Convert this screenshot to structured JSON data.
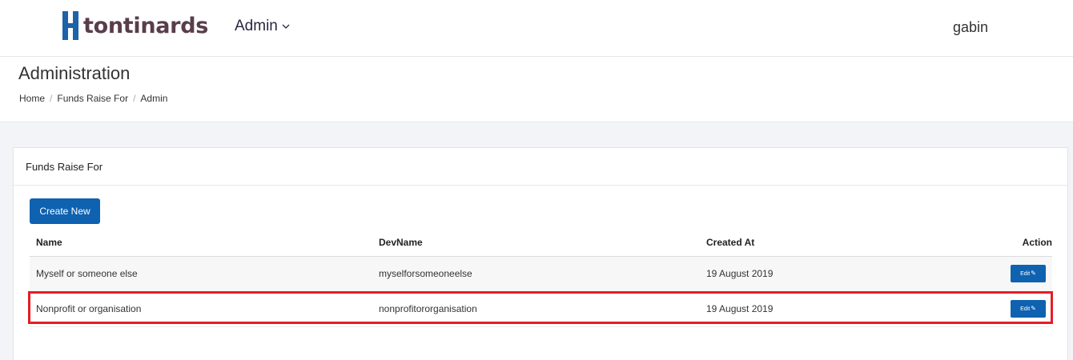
{
  "brand": {
    "name": "tontinards",
    "colors": {
      "logo_blue": "#1e63a8",
      "logo_text": "#5a3d4a"
    }
  },
  "nav": {
    "admin_label": "Admin",
    "user": "gabin"
  },
  "page": {
    "title": "Administration",
    "breadcrumb": [
      "Home",
      "Funds Raise For",
      "Admin"
    ]
  },
  "card": {
    "title": "Funds Raise For",
    "create_label": "Create New",
    "columns": [
      "Name",
      "DevName",
      "Created At",
      "Action"
    ],
    "rows": [
      {
        "name": "Myself or someone else",
        "devname": "myselforsomeoneelse",
        "created": "19 August 2019",
        "action": "Edit"
      },
      {
        "name": "Nonprofit or organisation",
        "devname": "nonprofitororganisation",
        "created": "19 August 2019",
        "action": "Edit"
      }
    ]
  },
  "colors": {
    "primary": "#0e62b0",
    "highlight": "#e41e26"
  }
}
